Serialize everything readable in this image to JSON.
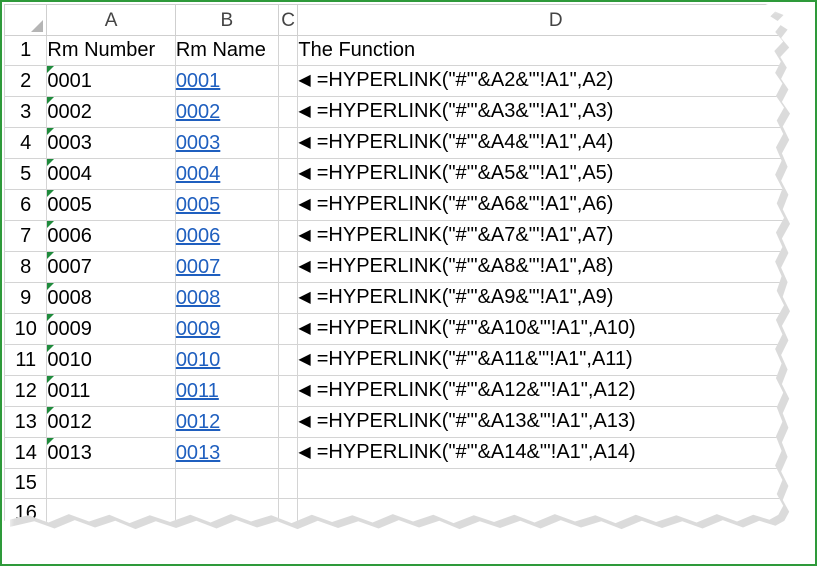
{
  "columns": [
    "A",
    "B",
    "C",
    "D"
  ],
  "header_row": {
    "row_number": "1",
    "a": "Rm Number",
    "b": "Rm Name",
    "c": "",
    "d": "The Function"
  },
  "rows": [
    {
      "num": "2",
      "a": "0001",
      "b": "0001",
      "arrow": "◀",
      "d": "=HYPERLINK(\"#'\"&A2&\"'!A1\",A2)"
    },
    {
      "num": "3",
      "a": "0002",
      "b": "0002",
      "arrow": "◀",
      "d": "=HYPERLINK(\"#'\"&A3&\"'!A1\",A3)"
    },
    {
      "num": "4",
      "a": "0003",
      "b": "0003",
      "arrow": "◀",
      "d": "=HYPERLINK(\"#'\"&A4&\"'!A1\",A4)"
    },
    {
      "num": "5",
      "a": "0004",
      "b": "0004",
      "arrow": "◀",
      "d": "=HYPERLINK(\"#'\"&A5&\"'!A1\",A5)"
    },
    {
      "num": "6",
      "a": "0005",
      "b": "0005",
      "arrow": "◀",
      "d": "=HYPERLINK(\"#'\"&A6&\"'!A1\",A6)"
    },
    {
      "num": "7",
      "a": "0006",
      "b": "0006",
      "arrow": "◀",
      "d": "=HYPERLINK(\"#'\"&A7&\"'!A1\",A7)"
    },
    {
      "num": "8",
      "a": "0007",
      "b": "0007",
      "arrow": "◀",
      "d": "=HYPERLINK(\"#'\"&A8&\"'!A1\",A8)"
    },
    {
      "num": "9",
      "a": "0008",
      "b": "0008",
      "arrow": "◀",
      "d": "=HYPERLINK(\"#'\"&A9&\"'!A1\",A9)"
    },
    {
      "num": "10",
      "a": "0009",
      "b": "0009",
      "arrow": "◀",
      "d": "=HYPERLINK(\"#'\"&A10&\"'!A1\",A10)"
    },
    {
      "num": "11",
      "a": "0010",
      "b": "0010",
      "arrow": "◀",
      "d": "=HYPERLINK(\"#'\"&A11&\"'!A1\",A11)"
    },
    {
      "num": "12",
      "a": "0011",
      "b": "0011",
      "arrow": "◀",
      "d": "=HYPERLINK(\"#'\"&A12&\"'!A1\",A12)"
    },
    {
      "num": "13",
      "a": "0012",
      "b": "0012",
      "arrow": "◀",
      "d": "=HYPERLINK(\"#'\"&A13&\"'!A1\",A13)"
    },
    {
      "num": "14",
      "a": "0013",
      "b": "0013",
      "arrow": "◀",
      "d": "=HYPERLINK(\"#'\"&A14&\"'!A1\",A14)"
    }
  ],
  "empty_rows": [
    "15",
    "16"
  ],
  "colors": {
    "frame_border": "#2e9a3a",
    "hyperlink": "#1f5fbf",
    "error_flag": "#1f8b3c",
    "gridline": "#d4d4d4"
  }
}
